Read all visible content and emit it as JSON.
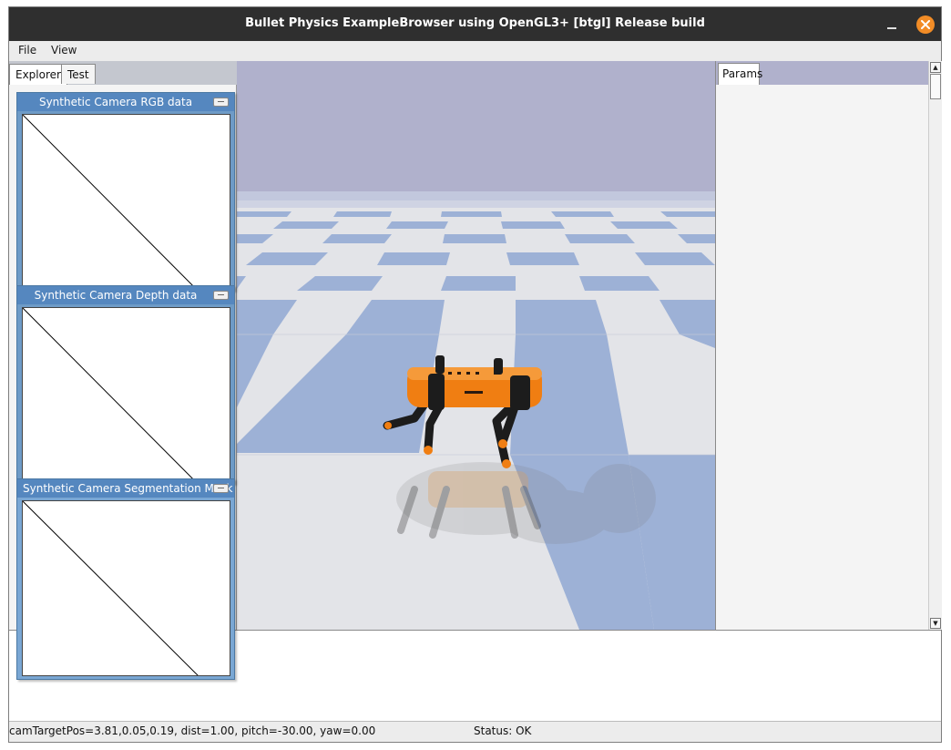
{
  "window": {
    "title": "Bullet Physics ExampleBrowser using OpenGL3+ [btgl] Release build",
    "minimize_icon": "minimize-icon",
    "close_icon": "close-icon",
    "accent_color": "#f28c26"
  },
  "menubar": {
    "items": [
      {
        "label": "File"
      },
      {
        "label": "View"
      }
    ]
  },
  "explorer_tabs": [
    {
      "label": "Explorer",
      "active": true
    },
    {
      "label": "Test",
      "active": false
    }
  ],
  "params": {
    "tab_label": "Params"
  },
  "camera_windows": [
    {
      "title": "Synthetic Camera RGB data"
    },
    {
      "title": "Synthetic Camera Depth data"
    },
    {
      "title": "Synthetic Camera Segmentation Mask"
    }
  ],
  "status": {
    "left": "camTargetPos=3.81,0.05,0.19, dist=1.00, pitch=-30.00, yaw=0.00",
    "right": "Status: OK"
  },
  "colors": {
    "sky": "#b0b1cc",
    "floor_light": "#e3e4e8",
    "floor_blue": "#9db1d6",
    "robot_orange": "#f07e12",
    "robot_legs": "#1c1c1c"
  }
}
